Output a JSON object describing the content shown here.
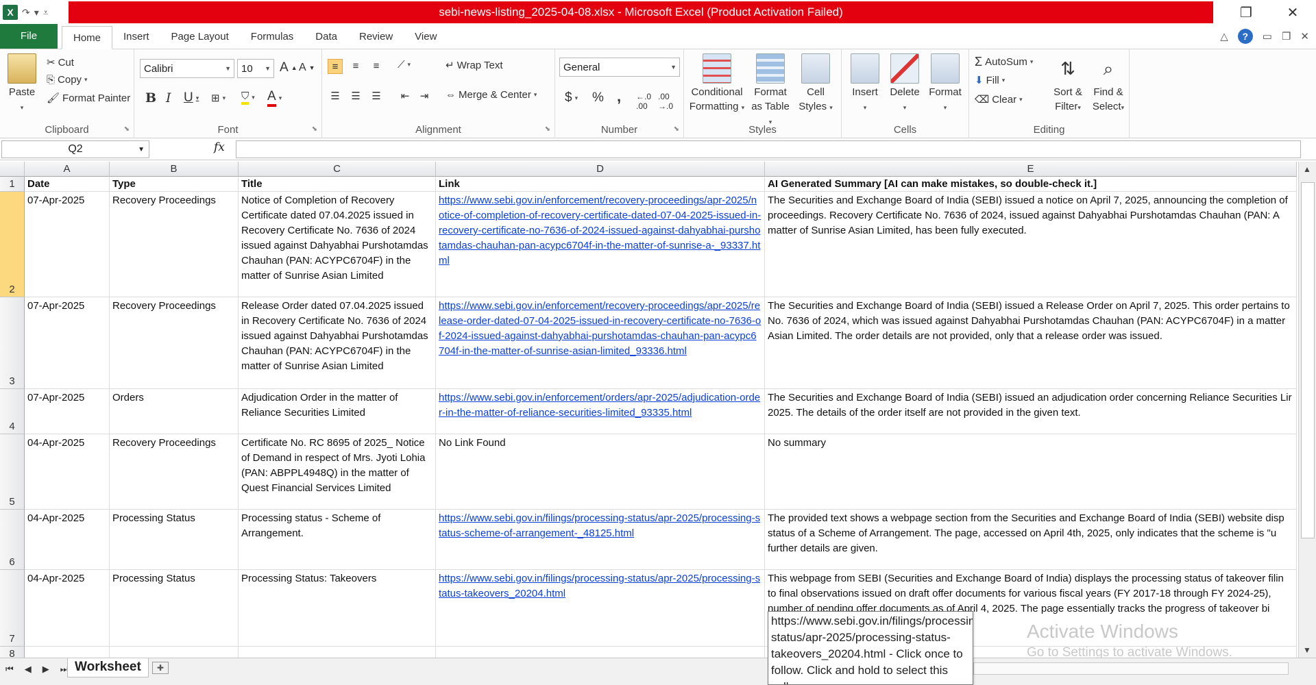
{
  "window": {
    "title": "sebi-news-listing_2025-04-08.xlsx  -  Microsoft Excel (Product Activation Failed)",
    "app_icon": "X"
  },
  "tabs": [
    {
      "label": "File"
    },
    {
      "label": "Home"
    },
    {
      "label": "Insert"
    },
    {
      "label": "Page Layout"
    },
    {
      "label": "Formulas"
    },
    {
      "label": "Data"
    },
    {
      "label": "Review"
    },
    {
      "label": "View"
    }
  ],
  "ribbon": {
    "clipboard": {
      "paste": "Paste",
      "cut": "Cut",
      "copy": "Copy",
      "format_painter": "Format Painter",
      "label": "Clipboard"
    },
    "font": {
      "name": "Calibri",
      "size": "10",
      "label": "Font"
    },
    "alignment": {
      "wrap_text": "Wrap Text",
      "merge_center": "Merge & Center",
      "label": "Alignment"
    },
    "number": {
      "format": "General",
      "currency": "$",
      "percent": "%",
      "comma": ",",
      "label": "Number"
    },
    "styles": {
      "conditional": "Conditional",
      "formatting": "Formatting",
      "format_as": "Format",
      "as_table": "as Table",
      "cell": "Cell",
      "styles_word": "Styles",
      "label": "Styles"
    },
    "cells": {
      "insert": "Insert",
      "delete": "Delete",
      "format": "Format",
      "label": "Cells"
    },
    "editing": {
      "autosum": "AutoSum",
      "fill": "Fill",
      "clear": "Clear",
      "sort": "Sort &",
      "filter": "Filter",
      "find": "Find &",
      "select": "Select",
      "label": "Editing"
    }
  },
  "formula_bar": {
    "name_box": "Q2",
    "fx": "fx",
    "content": ""
  },
  "columns": [
    "A",
    "B",
    "C",
    "D",
    "E"
  ],
  "rows": [
    {
      "num": "1",
      "date": "Date",
      "type": "Type",
      "title": "Title",
      "link": "Link",
      "summary": "AI Generated Summary [AI can make mistakes, so double-check it.]"
    },
    {
      "num": "2",
      "date": "07-Apr-2025",
      "type": "Recovery Proceedings",
      "title": "Notice of Completion of Recovery Certificate dated 07.04.2025 issued in Recovery Certificate No. 7636 of 2024 issued against Dahyabhai Purshotamdas Chauhan (PAN: ACYPC6704F) in the matter of Sunrise Asian Limited",
      "link": "https://www.sebi.gov.in/enforcement/recovery-proceedings/apr-2025/notice-of-completion-of-recovery-certificate-dated-07-04-2025-issued-in-recovery-certificate-no-7636-of-2024-issued-against-dahyabhai-purshotamdas-chauhan-pan-acypc6704f-in-the-matter-of-sunrise-a-_93337.html",
      "summary": "The Securities and Exchange Board of India (SEBI) issued a notice on April 7, 2025, announcing the completion of proceedings.  Recovery Certificate No. 7636 of 2024, issued against Dahyabhai Purshotamdas Chauhan (PAN: A matter of Sunrise Asian Limited, has been fully executed."
    },
    {
      "num": "3",
      "date": "07-Apr-2025",
      "type": "Recovery Proceedings",
      "title": "Release Order dated 07.04.2025 issued in Recovery Certificate No. 7636 of 2024 issued against Dahyabhai Purshotamdas Chauhan (PAN: ACYPC6704F) in the matter of Sunrise Asian Limited",
      "link": "https://www.sebi.gov.in/enforcement/recovery-proceedings/apr-2025/release-order-dated-07-04-2025-issued-in-recovery-certificate-no-7636-of-2024-issued-against-dahyabhai-purshotamdas-chauhan-pan-acypc6704f-in-the-matter-of-sunrise-asian-limited_93336.html",
      "summary": "The Securities and Exchange Board of India (SEBI) issued a Release Order on April 7, 2025.  This order pertains to No. 7636 of 2024, which was issued against Dahyabhai Purshotamdas Chauhan (PAN: ACYPC6704F) in a matter Asian Limited.  The order details are not provided, only that a release order was issued."
    },
    {
      "num": "4",
      "date": "07-Apr-2025",
      "type": "Orders",
      "title": "Adjudication Order in the matter of Reliance Securities Limited",
      "link": "https://www.sebi.gov.in/enforcement/orders/apr-2025/adjudication-order-in-the-matter-of-reliance-securities-limited_93335.html",
      "summary": "The Securities and Exchange Board of India (SEBI) issued an adjudication order concerning Reliance Securities Lir 2025.  The details of the order itself are not provided in the given text."
    },
    {
      "num": "5",
      "date": "04-Apr-2025",
      "type": "Recovery Proceedings",
      "title": "Certificate No. RC 8695 of 2025_ Notice of Demand in respect of Mrs. Jyoti Lohia (PAN: ABPPL4948Q) in the matter of Quest Financial Services Limited",
      "link": "No Link Found",
      "summary": "No summary"
    },
    {
      "num": "6",
      "date": "04-Apr-2025",
      "type": "Processing Status",
      "title": "Processing status - Scheme of Arrangement.",
      "link": "https://www.sebi.gov.in/filings/processing-status/apr-2025/processing-status-scheme-of-arrangement-_48125.html",
      "summary": "The provided text shows a webpage section from the Securities and Exchange Board of India (SEBI) website disp status of a Scheme of Arrangement.  The page, accessed on April 4th, 2025, only indicates that the scheme is \"u further details are given."
    },
    {
      "num": "7",
      "date": "04-Apr-2025",
      "type": "Processing Status",
      "title": "Processing Status: Takeovers",
      "link": "https://www.sebi.gov.in/filings/processing-status/apr-2025/processing-status-takeovers_20204.html",
      "summary": "This webpage from SEBI (Securities and Exchange Board of India) displays the processing status of takeover filin to final observations issued on draft offer documents for various fiscal years (FY 2017-18 through FY 2024-25), number of pending offer documents as of April 4, 2025.  The page essentially tracks the progress of takeover bi"
    },
    {
      "num": "8",
      "date": "",
      "type": "",
      "title": "",
      "link": "",
      "summary": ""
    }
  ],
  "tooltip": "https://www.sebi.gov.in/filings/processing-status/apr-2025/processing-status-takeovers_20204.html - Click once to follow. Click and hold to select this cell.",
  "watermark": {
    "line1": "Activate Windows",
    "line2": "Go to Settings to activate Windows."
  },
  "sheet_tab": "Worksheet",
  "colors": {
    "file_tab": "#1f7a3d",
    "title_bar": "#e3000f",
    "link": "#0b3fd8",
    "selected_row": "#fcd97e"
  }
}
